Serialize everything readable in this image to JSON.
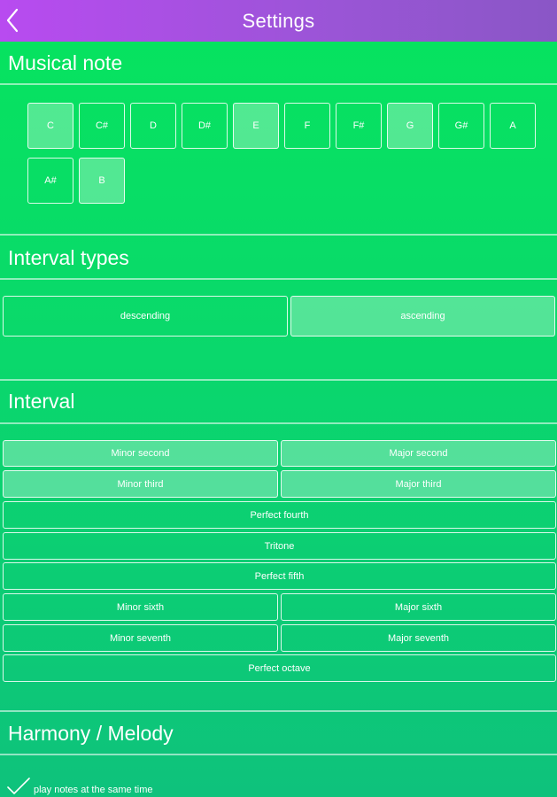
{
  "nav": {
    "title": "Settings",
    "back_icon": "chevron-left-icon"
  },
  "colors": {
    "nav_gradient_start": "#b84bf0",
    "nav_gradient_end": "#8a56c6",
    "bg_top": "#06e45e",
    "bg_bottom": "#0ec27c"
  },
  "sections": {
    "musical_note": "Musical note",
    "interval_types": "Interval types",
    "interval": "Interval",
    "harmony": "Harmony / Melody"
  },
  "notes": [
    {
      "label": "C",
      "selected": true
    },
    {
      "label": "C#",
      "selected": false
    },
    {
      "label": "D",
      "selected": false
    },
    {
      "label": "D#",
      "selected": false
    },
    {
      "label": "E",
      "selected": true
    },
    {
      "label": "F",
      "selected": false
    },
    {
      "label": "F#",
      "selected": false
    },
    {
      "label": "G",
      "selected": true
    },
    {
      "label": "G#",
      "selected": false
    },
    {
      "label": "A",
      "selected": false
    },
    {
      "label": "A#",
      "selected": false
    },
    {
      "label": "B",
      "selected": true
    }
  ],
  "interval_types": [
    {
      "label": "descending",
      "selected": false
    },
    {
      "label": "ascending",
      "selected": true
    }
  ],
  "intervals": {
    "minor_second": {
      "label": "Minor second",
      "selected": true
    },
    "major_second": {
      "label": "Major second",
      "selected": true
    },
    "minor_third": {
      "label": "Minor third",
      "selected": true
    },
    "major_third": {
      "label": "Major third",
      "selected": true
    },
    "perfect_fourth": {
      "label": "Perfect fourth",
      "selected": false
    },
    "tritone": {
      "label": "Tritone",
      "selected": false
    },
    "perfect_fifth": {
      "label": "Perfect fifth",
      "selected": false
    },
    "minor_sixth": {
      "label": "Minor sixth",
      "selected": false
    },
    "major_sixth": {
      "label": "Major sixth",
      "selected": false
    },
    "minor_seventh": {
      "label": "Minor seventh",
      "selected": false
    },
    "major_seventh": {
      "label": "Major seventh",
      "selected": false
    },
    "perfect_octave": {
      "label": "Perfect octave",
      "selected": false
    }
  },
  "harmony": {
    "checked": true,
    "label": "play notes at the same time"
  }
}
